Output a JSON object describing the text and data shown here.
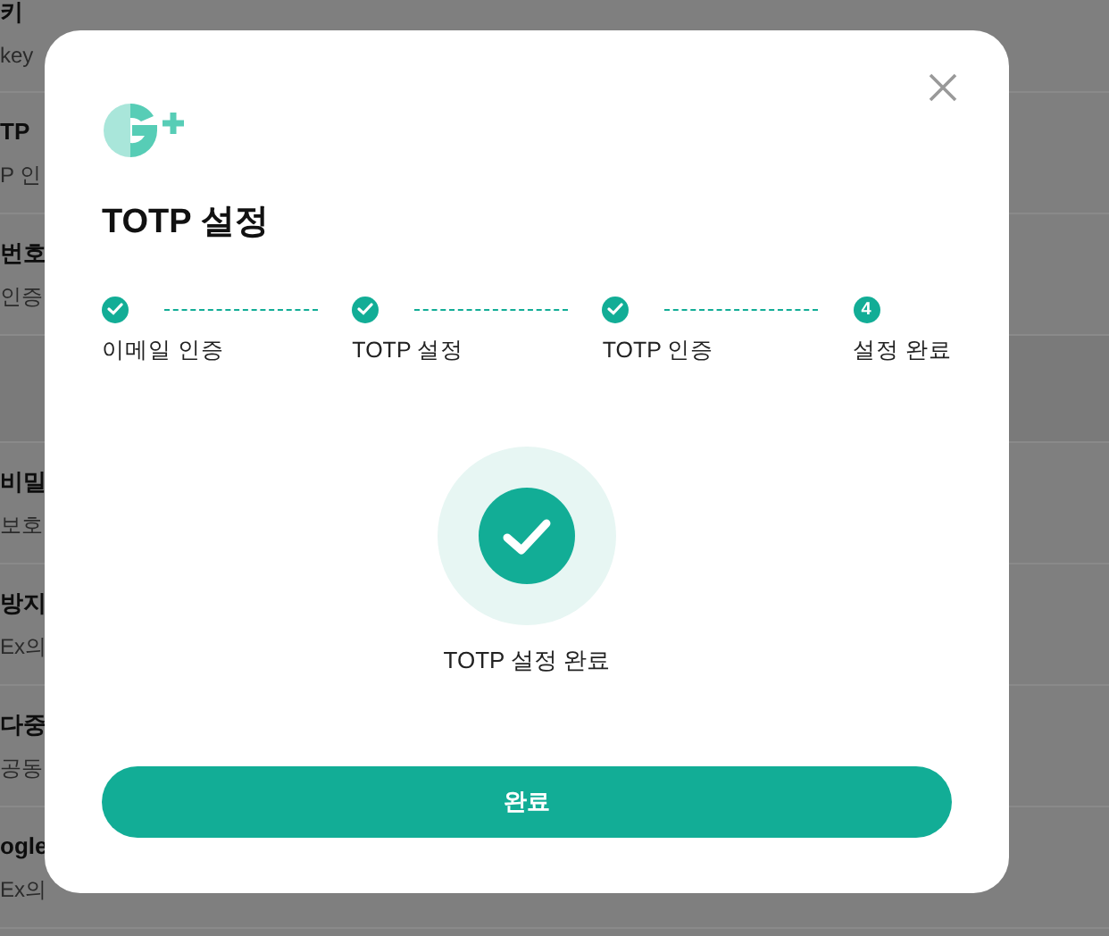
{
  "background_rows": [
    {
      "title": "키",
      "subtitle": "key"
    },
    {
      "title": "TP",
      "subtitle": "P 인"
    },
    {
      "title": "번호",
      "subtitle": "인증"
    },
    {
      "kind": "band"
    },
    {
      "title": "비밀",
      "subtitle": "보호"
    },
    {
      "title": "방지",
      "subtitle": "Ex의"
    },
    {
      "title": "다중",
      "subtitle": "공동"
    },
    {
      "title": "ogle",
      "subtitle": "Ex의"
    }
  ],
  "dialog": {
    "title": "TOTP 설정",
    "steps": [
      {
        "label": "이메일 인증",
        "done": true
      },
      {
        "label": "TOTP 설정",
        "done": true
      },
      {
        "label": "TOTP 인증",
        "done": true
      },
      {
        "label": "설정 완료",
        "done": false,
        "number": "4"
      }
    ],
    "result": "TOTP 설정 완료",
    "button": "완료"
  }
}
